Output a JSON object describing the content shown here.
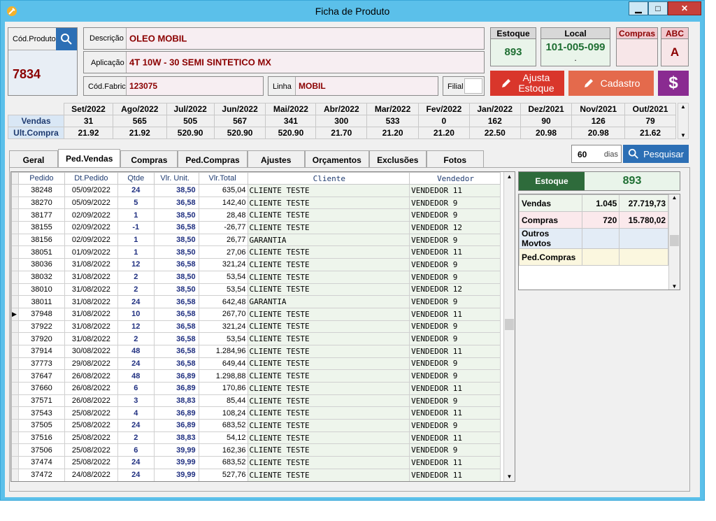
{
  "window": {
    "title": "Ficha de Produto"
  },
  "product": {
    "code_label": "Cód.Produto",
    "code": "7834",
    "descricao_label": "Descrição",
    "descricao": "OLEO MOBIL",
    "aplicacao_label": "Aplicação",
    "aplicacao": "4T 10W - 30 SEMI SINTETICO MX",
    "cod_fabric_label": "Cód.Fabric",
    "cod_fabric": "123075",
    "linha_label": "Linha",
    "linha": "MOBIL",
    "filial_label": "Filial"
  },
  "cards": {
    "estoque_label": "Estoque",
    "estoque": "893",
    "local_label": "Local",
    "local": "101-005-099",
    "local_sub": ".",
    "compras_label": "Compras",
    "abc_label": "ABC",
    "abc": "A"
  },
  "buttons": {
    "ajusta_line1": "Ajusta",
    "ajusta_line2": "Estoque",
    "cadastro": "Cadastro",
    "dollar": "$",
    "pesquisar": "Pesquisar"
  },
  "history": {
    "months": [
      "Set/2022",
      "Ago/2022",
      "Jul/2022",
      "Jun/2022",
      "Mai/2022",
      "Abr/2022",
      "Mar/2022",
      "Fev/2022",
      "Jan/2022",
      "Dez/2021",
      "Nov/2021",
      "Out/2021"
    ],
    "vendas_label": "Vendas",
    "vendas": [
      "31",
      "565",
      "505",
      "567",
      "341",
      "300",
      "533",
      "0",
      "162",
      "90",
      "126",
      "79"
    ],
    "ultcompra_label": "Ult.Compra",
    "ultcompra": [
      "21.92",
      "21.92",
      "520.90",
      "520.90",
      "520.90",
      "21.70",
      "21.20",
      "21.20",
      "22.50",
      "20.98",
      "20.98",
      "21.62"
    ]
  },
  "tabs": [
    "Geral",
    "Ped.Vendas",
    "Compras",
    "Ped.Compras",
    "Ajustes",
    "Orçamentos",
    "Exclusões",
    "Fotos"
  ],
  "filter": {
    "days_value": "60",
    "days_label": "dias"
  },
  "grid": {
    "headers": [
      "Pedido",
      "Dt.Pedido",
      "Qtde",
      "Vlr. Unit.",
      "Vlr.Total",
      "Cliente",
      "Vendedor"
    ],
    "rows": [
      [
        "38248",
        "05/09/2022",
        "24",
        "38,50",
        "635,04",
        "CLIENTE TESTE",
        "VENDEDOR 11"
      ],
      [
        "38270",
        "05/09/2022",
        "5",
        "36,58",
        "142,40",
        "CLIENTE TESTE",
        "VENDEDOR 9"
      ],
      [
        "38177",
        "02/09/2022",
        "1",
        "38,50",
        "28,48",
        "CLIENTE TESTE",
        "VENDEDOR 9"
      ],
      [
        "38155",
        "02/09/2022",
        "-1",
        "36,58",
        "-26,77",
        "CLIENTE TESTE",
        "VENDEDOR 12"
      ],
      [
        "38156",
        "02/09/2022",
        "1",
        "38,50",
        "26,77",
        "GARANTIA",
        "VENDEDOR 9"
      ],
      [
        "38051",
        "01/09/2022",
        "1",
        "38,50",
        "27,06",
        "CLIENTE TESTE",
        "VENDEDOR 11"
      ],
      [
        "38036",
        "31/08/2022",
        "12",
        "36,58",
        "321,24",
        "CLIENTE TESTE",
        "VENDEDOR 9"
      ],
      [
        "38032",
        "31/08/2022",
        "2",
        "38,50",
        "53,54",
        "CLIENTE TESTE",
        "VENDEDOR 9"
      ],
      [
        "38010",
        "31/08/2022",
        "2",
        "38,50",
        "53,54",
        "CLIENTE TESTE",
        "VENDEDOR 12"
      ],
      [
        "38011",
        "31/08/2022",
        "24",
        "36,58",
        "642,48",
        "GARANTIA",
        "VENDEDOR 9"
      ],
      [
        "37948",
        "31/08/2022",
        "10",
        "36,58",
        "267,70",
        "CLIENTE TESTE",
        "VENDEDOR 11"
      ],
      [
        "37922",
        "31/08/2022",
        "12",
        "36,58",
        "321,24",
        "CLIENTE TESTE",
        "VENDEDOR 9"
      ],
      [
        "37920",
        "31/08/2022",
        "2",
        "36,58",
        "53,54",
        "CLIENTE TESTE",
        "VENDEDOR 9"
      ],
      [
        "37914",
        "30/08/2022",
        "48",
        "36,58",
        "1.284,96",
        "CLIENTE TESTE",
        "VENDEDOR 11"
      ],
      [
        "37773",
        "29/08/2022",
        "24",
        "36,58",
        "649,44",
        "CLIENTE TESTE",
        "VENDEDOR 9"
      ],
      [
        "37647",
        "26/08/2022",
        "48",
        "36,89",
        "1.298,88",
        "CLIENTE TESTE",
        "VENDEDOR 9"
      ],
      [
        "37660",
        "26/08/2022",
        "6",
        "36,89",
        "170,86",
        "CLIENTE TESTE",
        "VENDEDOR 11"
      ],
      [
        "37571",
        "26/08/2022",
        "3",
        "38,83",
        "85,44",
        "CLIENTE TESTE",
        "VENDEDOR 9"
      ],
      [
        "37543",
        "25/08/2022",
        "4",
        "36,89",
        "108,24",
        "CLIENTE TESTE",
        "VENDEDOR 11"
      ],
      [
        "37505",
        "25/08/2022",
        "24",
        "36,89",
        "683,52",
        "CLIENTE TESTE",
        "VENDEDOR 9"
      ],
      [
        "37516",
        "25/08/2022",
        "2",
        "38,83",
        "54,12",
        "CLIENTE TESTE",
        "VENDEDOR 11"
      ],
      [
        "37506",
        "25/08/2022",
        "6",
        "39,99",
        "162,36",
        "CLIENTE TESTE",
        "VENDEDOR 9"
      ],
      [
        "37474",
        "25/08/2022",
        "24",
        "39,99",
        "683,52",
        "CLIENTE TESTE",
        "VENDEDOR 11"
      ],
      [
        "37472",
        "24/08/2022",
        "24",
        "39,99",
        "527,76",
        "CLIENTE TESTE",
        "VENDEDOR 11"
      ]
    ]
  },
  "side": {
    "estoque_label": "Estoque",
    "estoque": "893",
    "rows": [
      [
        "Vendas",
        "1.045",
        "27.719,73"
      ],
      [
        "Compras",
        "720",
        "15.780,02"
      ],
      [
        "Outros Movtos",
        "",
        ""
      ],
      [
        "Ped.Compras",
        "",
        ""
      ]
    ]
  }
}
